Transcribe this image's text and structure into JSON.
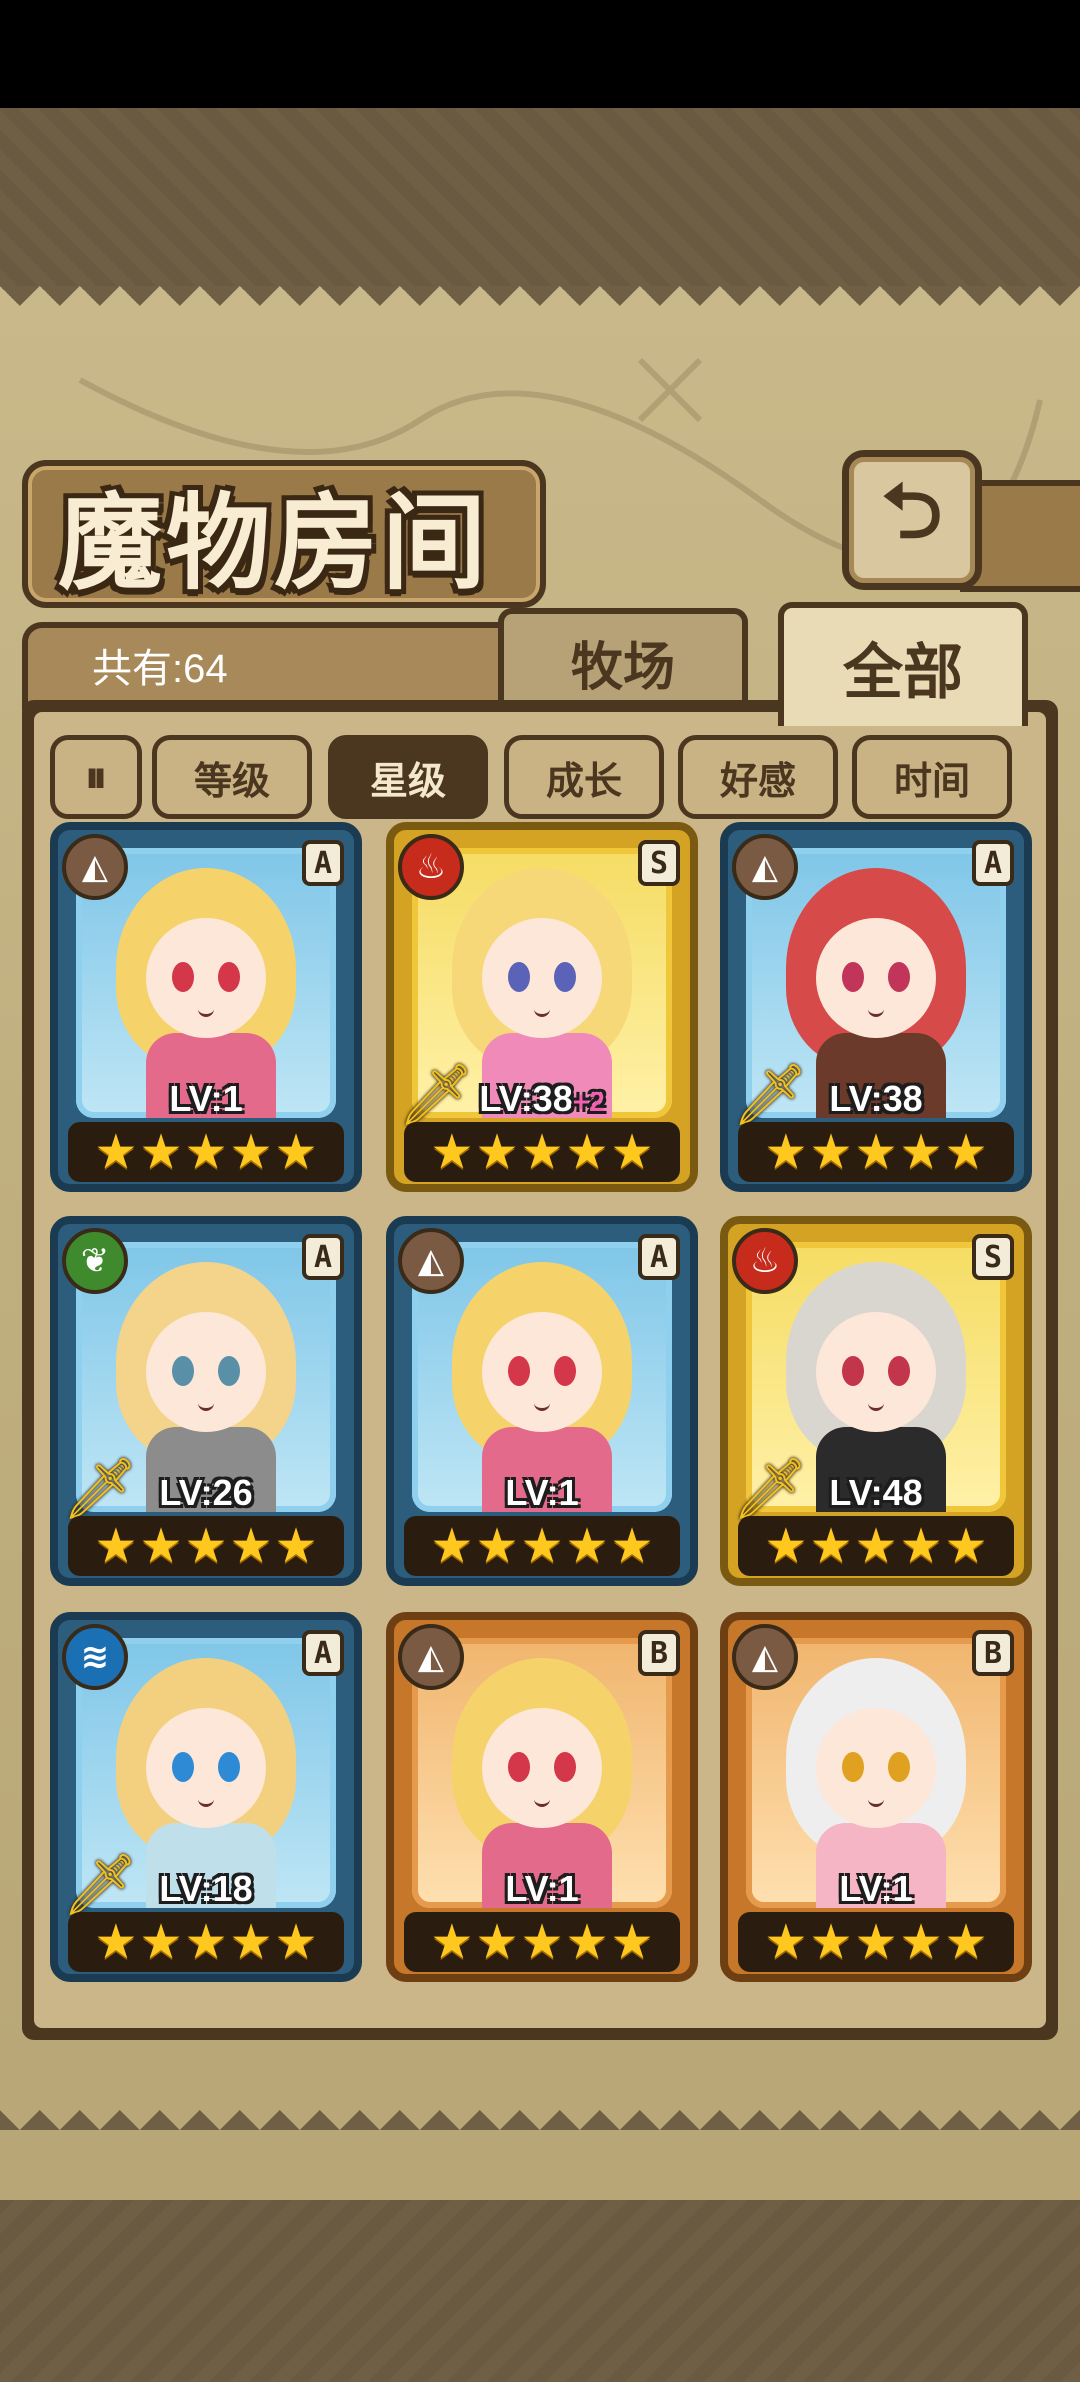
{
  "header": {
    "title": "魔物房间",
    "back_icon": "back-arrow-icon"
  },
  "info": {
    "total_label": "共有:64"
  },
  "tabs": [
    {
      "label": "牧场",
      "active": false
    },
    {
      "label": "全部",
      "active": true
    }
  ],
  "sort": {
    "toggle_icon": "sort-direction-icon",
    "buttons": [
      {
        "label": "等级",
        "active": false
      },
      {
        "label": "星级",
        "active": true
      },
      {
        "label": "成长",
        "active": false
      },
      {
        "label": "好感",
        "active": false
      },
      {
        "label": "时间",
        "active": false
      }
    ]
  },
  "monsters": [
    {
      "level": "LV:1",
      "bonus": "",
      "rank": "A",
      "element": "earth",
      "stars": 5,
      "weapon": false,
      "hair": "#f5d36a",
      "eye": "#d4364a",
      "outfit": "#e46a8b"
    },
    {
      "level": "LV:38",
      "bonus": "+2",
      "rank": "S",
      "element": "fire",
      "stars": 5,
      "weapon": true,
      "hair": "#f7d878",
      "eye": "#5a63b8",
      "outfit": "#f08ab8"
    },
    {
      "level": "LV:38",
      "bonus": "",
      "rank": "A",
      "element": "earth",
      "stars": 5,
      "weapon": true,
      "hair": "#d64a4a",
      "eye": "#c2355a",
      "outfit": "#6b3a2a"
    },
    {
      "level": "LV:26",
      "bonus": "",
      "rank": "A",
      "element": "wood",
      "stars": 5,
      "weapon": true,
      "hair": "#f3d48a",
      "eye": "#5a8fa8",
      "outfit": "#8c8c8c"
    },
    {
      "level": "LV:1",
      "bonus": "",
      "rank": "A",
      "element": "earth",
      "stars": 5,
      "weapon": false,
      "hair": "#f5d36a",
      "eye": "#d4364a",
      "outfit": "#e46a8b"
    },
    {
      "level": "LV:48",
      "bonus": "",
      "rank": "S",
      "element": "fire",
      "stars": 5,
      "weapon": true,
      "hair": "#d9d6cf",
      "eye": "#c2354a",
      "outfit": "#2b2b2b"
    },
    {
      "level": "LV:18",
      "bonus": "",
      "rank": "A",
      "element": "water",
      "stars": 5,
      "weapon": true,
      "hair": "#f3d080",
      "eye": "#2f8ad6",
      "outfit": "#bfe0ea"
    },
    {
      "level": "LV:1",
      "bonus": "",
      "rank": "B",
      "element": "earth",
      "stars": 5,
      "weapon": false,
      "hair": "#f5d36a",
      "eye": "#d4364a",
      "outfit": "#e46a8b"
    },
    {
      "level": "LV:1",
      "bonus": "",
      "rank": "B",
      "element": "earth",
      "stars": 5,
      "weapon": false,
      "hair": "#eeeeee",
      "eye": "#e0a020",
      "outfit": "#f5b5c4"
    }
  ],
  "colors": {
    "frame": "#4b3620",
    "parchment": "#c9b98a",
    "star": "#ffc81e"
  }
}
